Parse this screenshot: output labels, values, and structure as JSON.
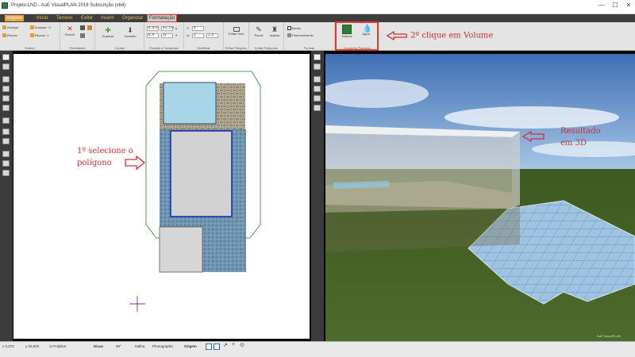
{
  "window": {
    "title": "Projeto.LND - AuE VisualPLAN 2018 Subscrição (x64)",
    "controls": [
      "—",
      "☐",
      "✕"
    ]
  },
  "menu": {
    "items": [
      "Arquivo",
      "Início",
      "Terreno",
      "Exibir",
      "Inserir",
      "Organizar",
      "Formatação"
    ],
    "active": "Formatação"
  },
  "ribbon": {
    "groups": {
      "ordem": {
        "label": "Ordem",
        "buttons": [
          "Avançar",
          "Recuar",
          "Avançar +1",
          "Recuar -1"
        ]
      },
      "propriedades": {
        "label": "Prioridades",
        "buttons": [
          "Excluir"
        ]
      },
      "copias": {
        "label": "Cópias",
        "buttons": [
          "Duplicar",
          "Carimbo"
        ]
      },
      "posicao": {
        "label": "Posição e Tamanhos",
        "fields": [
          "0,872",
          "24,271",
          "8,0",
          "11"
        ]
      },
      "modificar": {
        "label": "Modificar",
        "fields": [
          "0",
          "2",
          "1,0"
        ]
      },
      "editar_poligono": {
        "label": "Editar Polígono",
        "buttons": [
          "Editar Vért."
        ]
      },
      "editar_poligonos": {
        "label": "Editar Polígonos",
        "buttons": [
          "Pincel",
          "Aplicar"
        ]
      },
      "formas": {
        "label": "Formas",
        "buttons": [
          "Borda",
          "Preenchimento"
        ]
      },
      "converter": {
        "label": "Converter Polígono",
        "buttons": [
          "Volume",
          "Água"
        ]
      }
    }
  },
  "annotations": {
    "step2": "2º clique em Volume",
    "step1": "1º selecione o polígono",
    "result": "Resultado em 3D"
  },
  "view3d": {
    "stamp": "AuE VisualPLAN"
  },
  "status": {
    "x": "x 0,372",
    "y": "y 33,923",
    "object": "2) Polylina",
    "dicas": "Dicas",
    "angle": "90°",
    "malha": "Malha",
    "photographic": "Photographic",
    "origem": "Origem"
  },
  "colors": {
    "annotation_red": "#d32f2f",
    "menu_gold": "#e8c15a",
    "selection_blue": "#1f2fb3",
    "plan_outline_green": "#2e7d32"
  }
}
